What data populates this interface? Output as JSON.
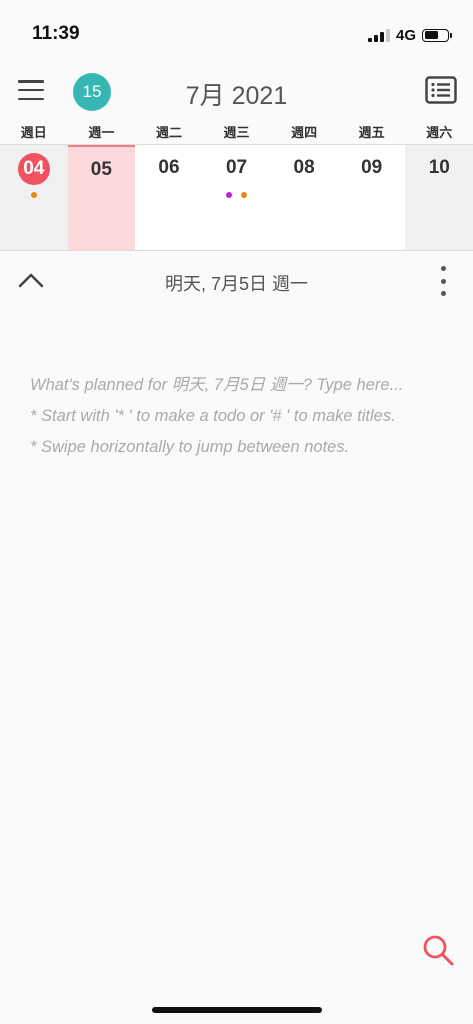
{
  "status": {
    "time": "11:39",
    "network": "4G"
  },
  "header": {
    "today_badge": "15",
    "month_title": "7月 2021"
  },
  "weekdays": [
    "週日",
    "週一",
    "週二",
    "週三",
    "週四",
    "週五",
    "週六"
  ],
  "days": [
    {
      "num": "04",
      "today": true,
      "dots": [
        "#e8890c"
      ]
    },
    {
      "num": "05",
      "selected": true,
      "dots": []
    },
    {
      "num": "06",
      "dots": []
    },
    {
      "num": "07",
      "dots": [
        "#c71ad8",
        "#e8890c"
      ]
    },
    {
      "num": "08",
      "dots": []
    },
    {
      "num": "09",
      "dots": []
    },
    {
      "num": "10",
      "dots": []
    }
  ],
  "note": {
    "title": "明天, 7月5日 週一",
    "placeholder_lines": [
      "What's planned for 明天, 7月5日 週一? Type here...",
      "* Start with '* ' to make a todo or '# ' to make titles.",
      "* Swipe horizontally to jump between notes."
    ]
  },
  "colors": {
    "accent_teal": "#36b7b3",
    "accent_red": "#f0525f",
    "selected_bg": "#fed9db"
  }
}
